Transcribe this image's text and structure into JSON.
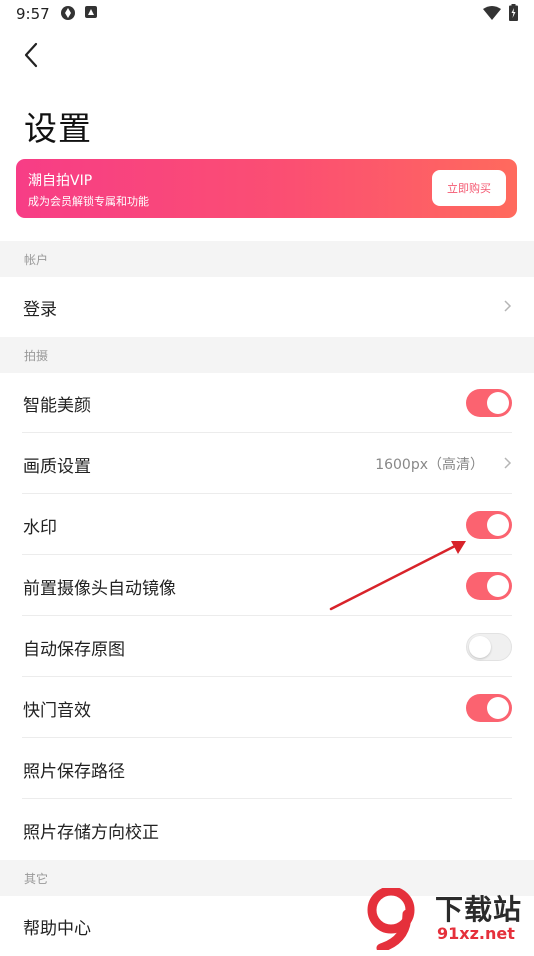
{
  "status_bar": {
    "time": "9:57"
  },
  "page_title": "设置",
  "vip": {
    "title": "潮自拍VIP",
    "subtitle": "成为会员解锁专属和功能",
    "buy_label": "立即购买"
  },
  "sections": {
    "account": "帐户",
    "shooting": "拍摄",
    "other": "其它"
  },
  "rows": {
    "login": "登录",
    "beauty": "智能美颜",
    "quality": "画质设置",
    "quality_value": "1600px（高清）",
    "watermark": "水印",
    "mirror": "前置摄像头自动镜像",
    "save_original": "自动保存原图",
    "shutter_sound": "快门音效",
    "save_path": "照片保存路径",
    "orientation": "照片存储方向校正",
    "help": "帮助中心"
  },
  "toggles": {
    "beauty": true,
    "watermark": true,
    "mirror": true,
    "save_original": false,
    "shutter_sound": true
  },
  "watermark_brand": {
    "name": "下载站",
    "url": "91xz.net",
    "logo_text": "9"
  },
  "colors": {
    "accent": "#fb6370",
    "vip_start": "#f73d86",
    "vip_end": "#ff6a5d",
    "annotation_arrow": "#d8232a"
  },
  "icons": [
    "settings-app-icon",
    "accessibility-icon",
    "wifi-icon",
    "battery-icon",
    "back-arrow-icon",
    "chevron-right-icon"
  ]
}
